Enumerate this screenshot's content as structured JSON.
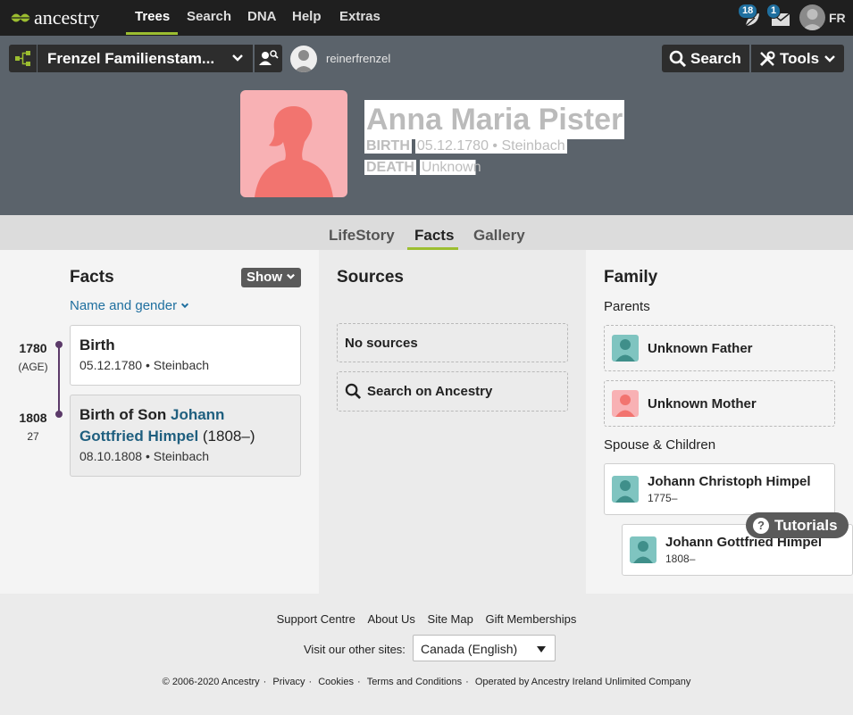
{
  "topnav": {
    "logo_text": "ancestry",
    "links": [
      "Trees",
      "Search",
      "DNA",
      "Help",
      "Extras"
    ],
    "notifications_count": "18",
    "messages_count": "1",
    "user_initials": "FR"
  },
  "treebar": {
    "tree_name": "Frenzel Familienstam...",
    "owner": "reinerfrenzel",
    "search_label": "Search",
    "tools_label": "Tools"
  },
  "person": {
    "name": "Anna Maria Pister",
    "birth_label": "BIRTH",
    "birth_value": "05.12.1780 • Steinbach",
    "death_label": "DEATH",
    "death_value": "Unknown"
  },
  "tabs": [
    "LifeStory",
    "Facts",
    "Gallery"
  ],
  "facts": {
    "title": "Facts",
    "show_label": "Show",
    "filter_label": "Name and gender",
    "events": [
      {
        "year": "1780",
        "age": "(AGE)",
        "title": "Birth",
        "detail": "05.12.1780 • Steinbach"
      },
      {
        "year": "1808",
        "age": "27",
        "title_prefix": "Birth of Son ",
        "title_link": "Johann Gottfried Himpel",
        "title_suffix": " (1808–)",
        "detail": "08.10.1808 • Steinbach"
      }
    ]
  },
  "sources": {
    "title": "Sources",
    "no_sources": "No sources",
    "search_ancestry": "Search on Ancestry"
  },
  "family": {
    "title": "Family",
    "parents_label": "Parents",
    "father": "Unknown Father",
    "mother": "Unknown Mother",
    "spouse_label": "Spouse & Children",
    "spouse_name": "Johann Christoph Himpel",
    "spouse_years": "1775–",
    "child_name": "Johann Gottfried Himpel",
    "child_years": "1808–"
  },
  "tutorials_label": "Tutorials",
  "footer": {
    "links": [
      "Support Centre",
      "About Us",
      "Site Map",
      "Gift Memberships"
    ],
    "visit_label": "Visit our other sites:",
    "site_selected": "Canada (English)",
    "copyright": "© 2006-2020 Ancestry",
    "legal_links": [
      "Privacy",
      "Cookies",
      "Terms and Conditions",
      "Operated by Ancestry Ireland Unlimited Company"
    ]
  },
  "colors": {
    "accent_green": "#9cbe30",
    "link_blue": "#1f6f9f",
    "female_pink": "#f8b1b4",
    "male_teal": "#7fc4c0"
  }
}
